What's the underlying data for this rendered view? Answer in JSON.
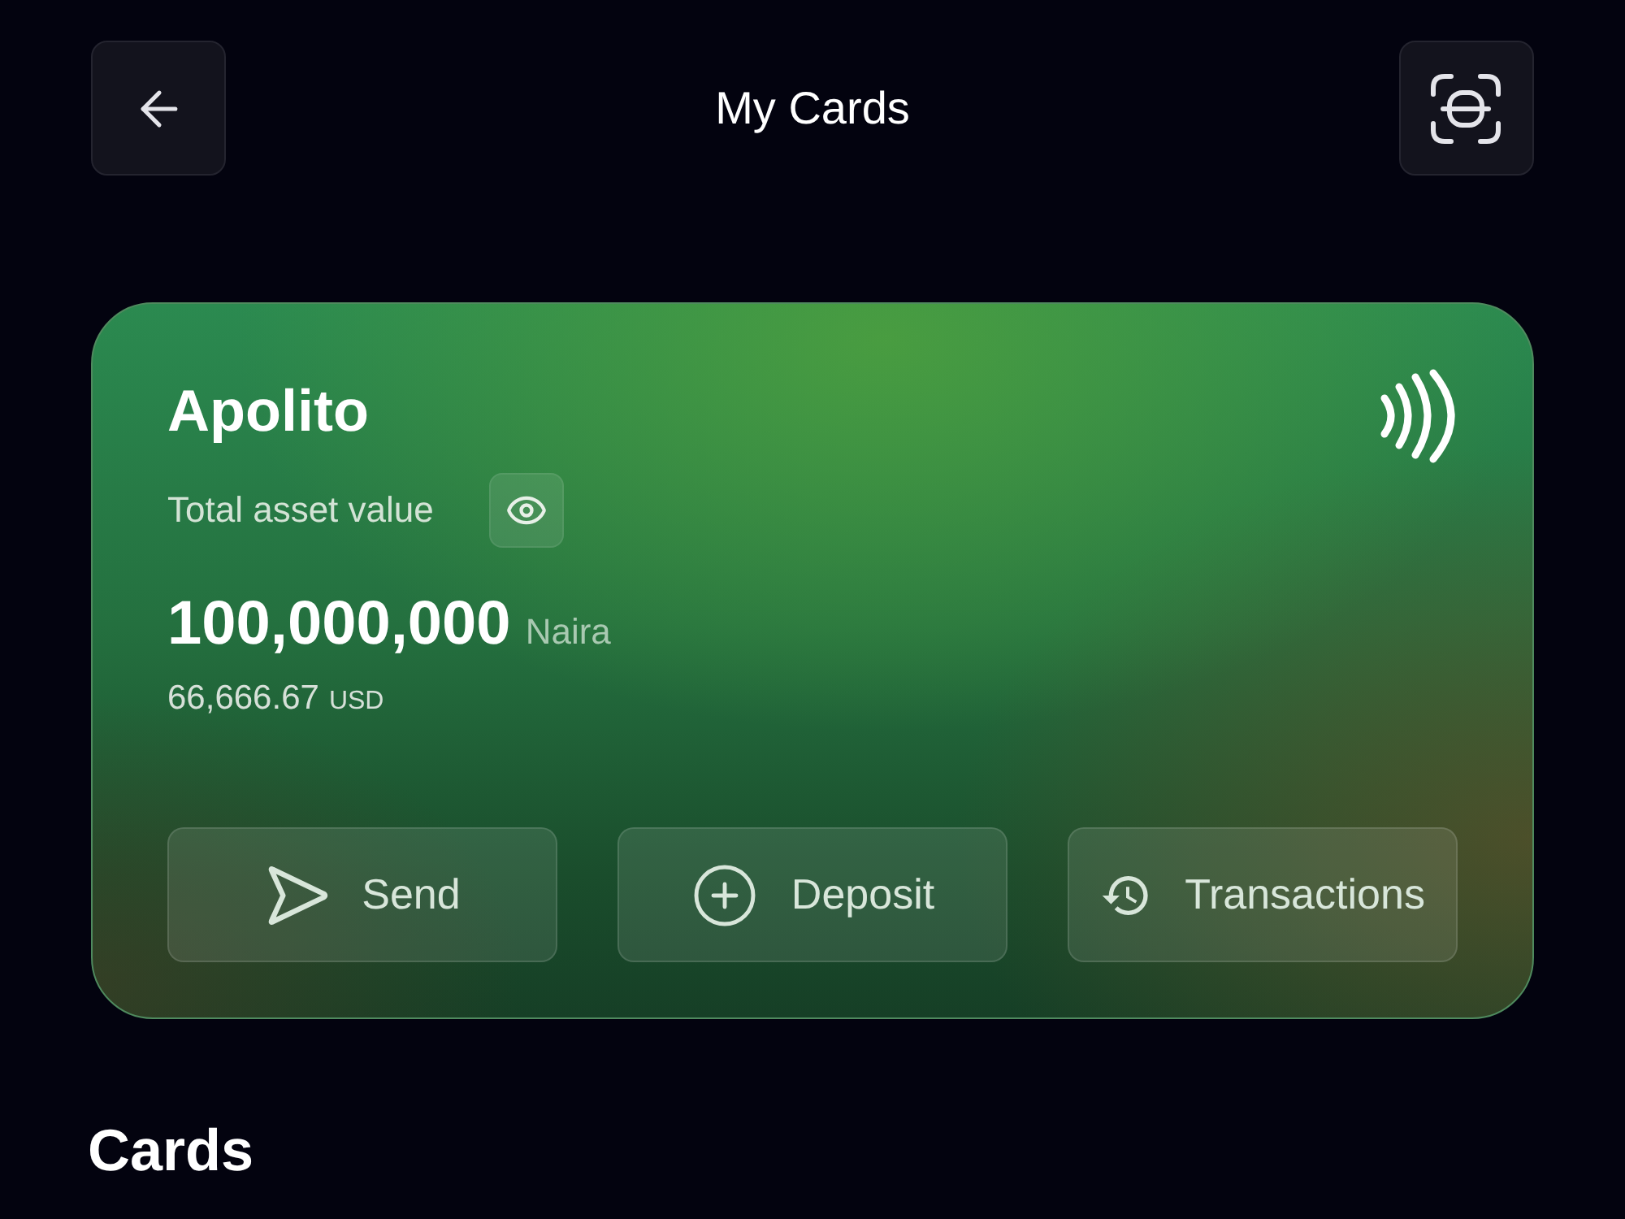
{
  "header": {
    "title": "My Cards"
  },
  "card": {
    "name": "Apolito",
    "balance_label": "Total asset value",
    "amount": "100,000,000",
    "currency": "Naira",
    "converted_amount": "66,666.67",
    "converted_currency": "USD",
    "actions": [
      {
        "kind": "send",
        "label": "Send"
      },
      {
        "kind": "deposit",
        "label": "Deposit"
      },
      {
        "kind": "transactions",
        "label": "Transactions"
      }
    ]
  },
  "section_title": "Cards"
}
